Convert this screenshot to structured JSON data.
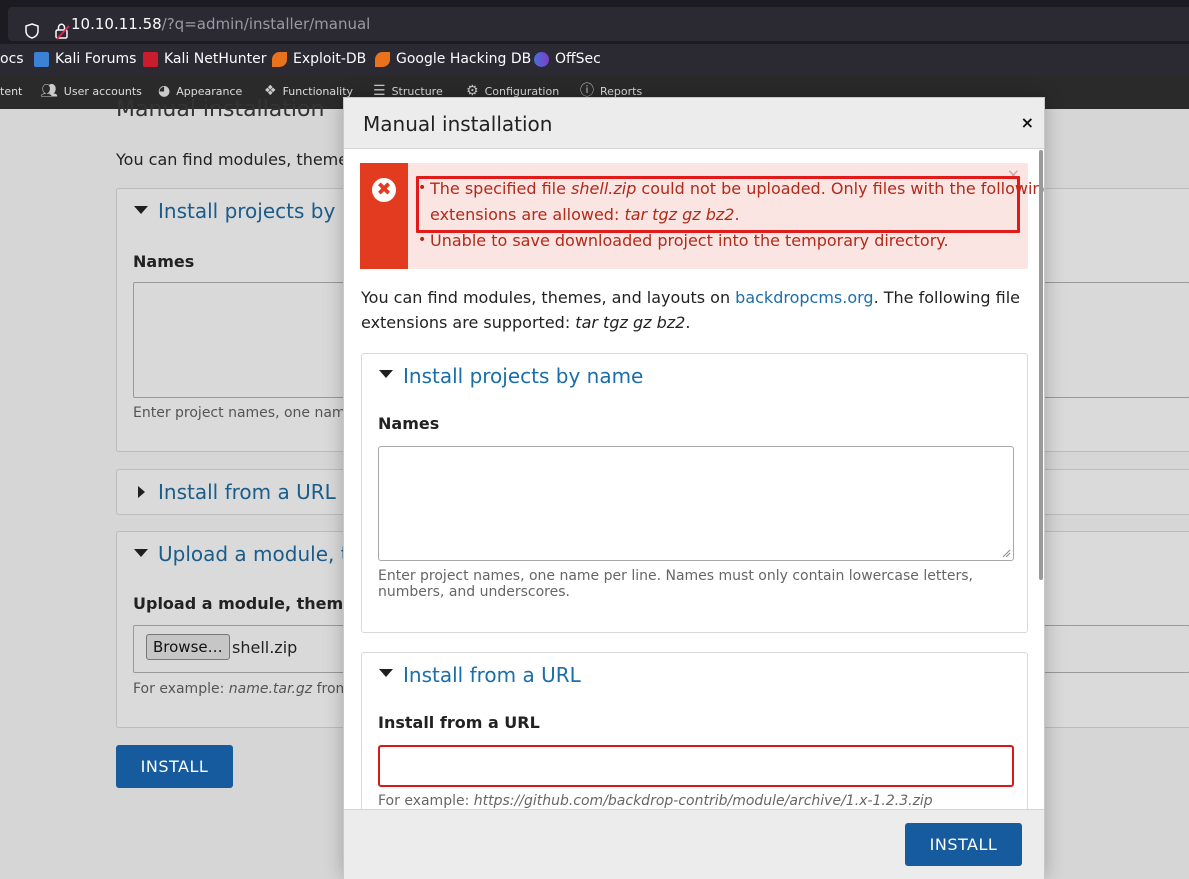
{
  "browser": {
    "url_host": "10.10.11.58",
    "url_path": "/?q=admin/installer/manual"
  },
  "bookmarks": [
    {
      "label": "ocs",
      "icon": "docs-icon"
    },
    {
      "label": "Kali Forums",
      "icon": "kali-forums-icon"
    },
    {
      "label": "Kali NetHunter",
      "icon": "kali-nethunter-icon"
    },
    {
      "label": "Exploit-DB",
      "icon": "exploit-db-icon"
    },
    {
      "label": "Google Hacking DB",
      "icon": "ghdb-icon"
    },
    {
      "label": "OffSec",
      "icon": "offsec-icon"
    }
  ],
  "admin_menu": [
    {
      "label": "tent",
      "icon": ""
    },
    {
      "label": "User accounts",
      "icon": "users-icon"
    },
    {
      "label": "Appearance",
      "icon": "palette-icon"
    },
    {
      "label": "Functionality",
      "icon": "puzzle-icon"
    },
    {
      "label": "Structure",
      "icon": "layers-icon"
    },
    {
      "label": "Configuration",
      "icon": "gear-icon"
    },
    {
      "label": "Reports",
      "icon": "info-icon"
    }
  ],
  "background_page": {
    "title": "Manual installation",
    "intro": "You can find modules, themes,",
    "fieldset_name_legend": "Install projects by na",
    "names_label": "Names",
    "names_desc": "Enter project names, one name",
    "fieldset_url_legend": "Install from a URL",
    "fieldset_upload_legend": "Upload a module, the",
    "upload_label": "Upload a module, theme, o",
    "browse_label": "Browse…",
    "file_name": "shell.zip",
    "upload_example_prefix": "For example: ",
    "upload_example_italic": "name.tar.gz",
    "upload_example_suffix": " from",
    "install_button": "INSTALL"
  },
  "modal": {
    "title": "Manual installation",
    "close_symbol": "×",
    "errors": {
      "line1_a": "The specified file ",
      "line1_file": "shell.zip",
      "line1_b": " could not be uploaded. Only files with the following",
      "line2_a": "extensions are allowed: ",
      "line2_ext": "tar tgz gz bz2",
      "line2_b": ".",
      "line3": "Unable to save downloaded project into the temporary directory.",
      "dismiss_symbol": "×"
    },
    "intro_a": "You can find modules, themes, and layouts on ",
    "intro_link": "backdropcms.org",
    "intro_b": ". The following file",
    "intro2_a": "extensions are supported: ",
    "intro2_ext": "tar tgz gz bz2",
    "intro2_b": ".",
    "fieldset_name": {
      "legend": "Install projects by name",
      "label": "Names",
      "value": "",
      "desc": "Enter project names, one name per line. Names must only contain lowercase letters, numbers, and underscores."
    },
    "fieldset_url": {
      "legend": "Install from a URL",
      "label": "Install from a URL",
      "value": "",
      "example_prefix": "For example: ",
      "example_url": "https://github.com/backdrop-contrib/module/archive/1.x-1.2.3.zip"
    },
    "install_button": "INSTALL"
  },
  "colors": {
    "accent": "#165b9e",
    "link": "#1a6eab",
    "error": "#e23b20",
    "error_text": "#b12a1a"
  }
}
